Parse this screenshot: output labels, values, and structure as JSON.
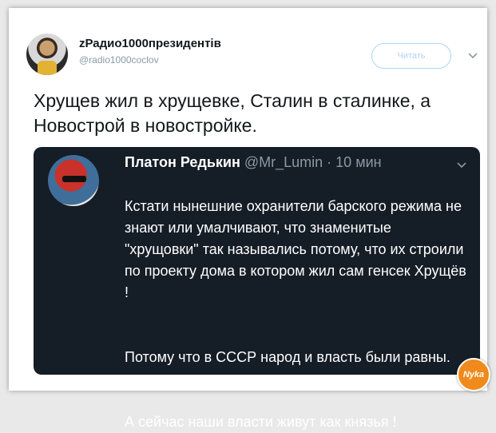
{
  "tweet": {
    "author_name": "zРадио1000президентів",
    "author_handle": "@radio1000coclov",
    "follow_label": "Читать",
    "text": "Хрущев жил в хрущевке, Сталин в сталинке, а Новострой в новостройке."
  },
  "quoted": {
    "name": "Платон Редькин",
    "handle": "@Mr_Lumin",
    "time": "· 10 мин",
    "lines": [
      "Кстати нынешние охранители барского режима не знают или умалчивают, что знаменитые \"хрущовки\" так назывались потому, что их строили по проекту дома в котором жил сам генсек Хрущёв !",
      "Потому что в СССР народ и власть были равны.",
      "А сейчас наши власти живут как князья !"
    ]
  },
  "watermark": {
    "text": "Nyka"
  },
  "colors": {
    "background": "#e9e9e9",
    "card": "#ffffff",
    "quote_bg": "#151d26",
    "follow_border": "#aed4f3",
    "watermark": "#f08a1c"
  },
  "icons": {
    "more": "chevron-down-icon",
    "quote_more": "chevron-down-icon"
  }
}
